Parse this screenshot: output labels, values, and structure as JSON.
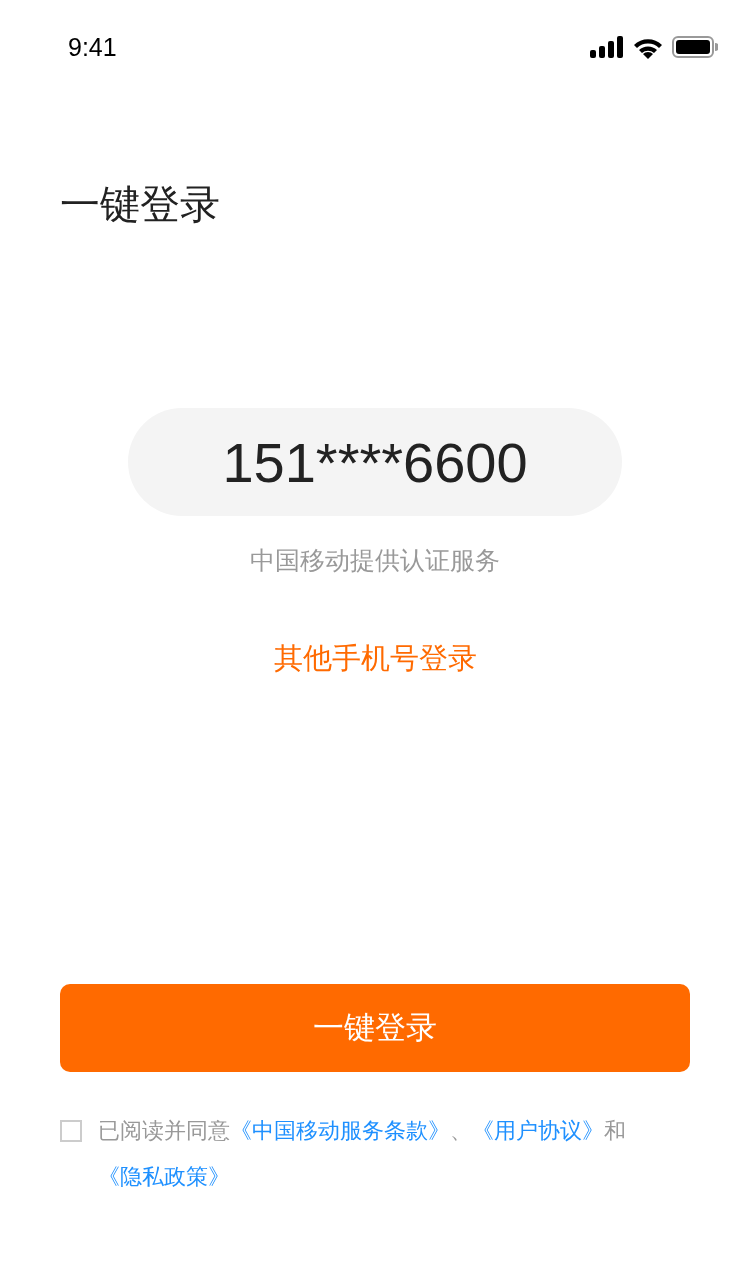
{
  "status_bar": {
    "time": "9:41"
  },
  "title": "一键登录",
  "phone_number": "151****6600",
  "provider_note": "中国移动提供认证服务",
  "other_login_link": "其他手机号登录",
  "login_button": "一键登录",
  "agreement": {
    "checked": false,
    "parts": [
      {
        "kind": "text",
        "text": "已阅读并同意"
      },
      {
        "kind": "link",
        "text": "《中国移动服务条款》"
      },
      {
        "kind": "text",
        "text": "、"
      },
      {
        "kind": "link",
        "text": "《用户协议》"
      },
      {
        "kind": "text",
        "text": "和"
      },
      {
        "kind": "link",
        "text": "《隐私政策》"
      }
    ]
  }
}
